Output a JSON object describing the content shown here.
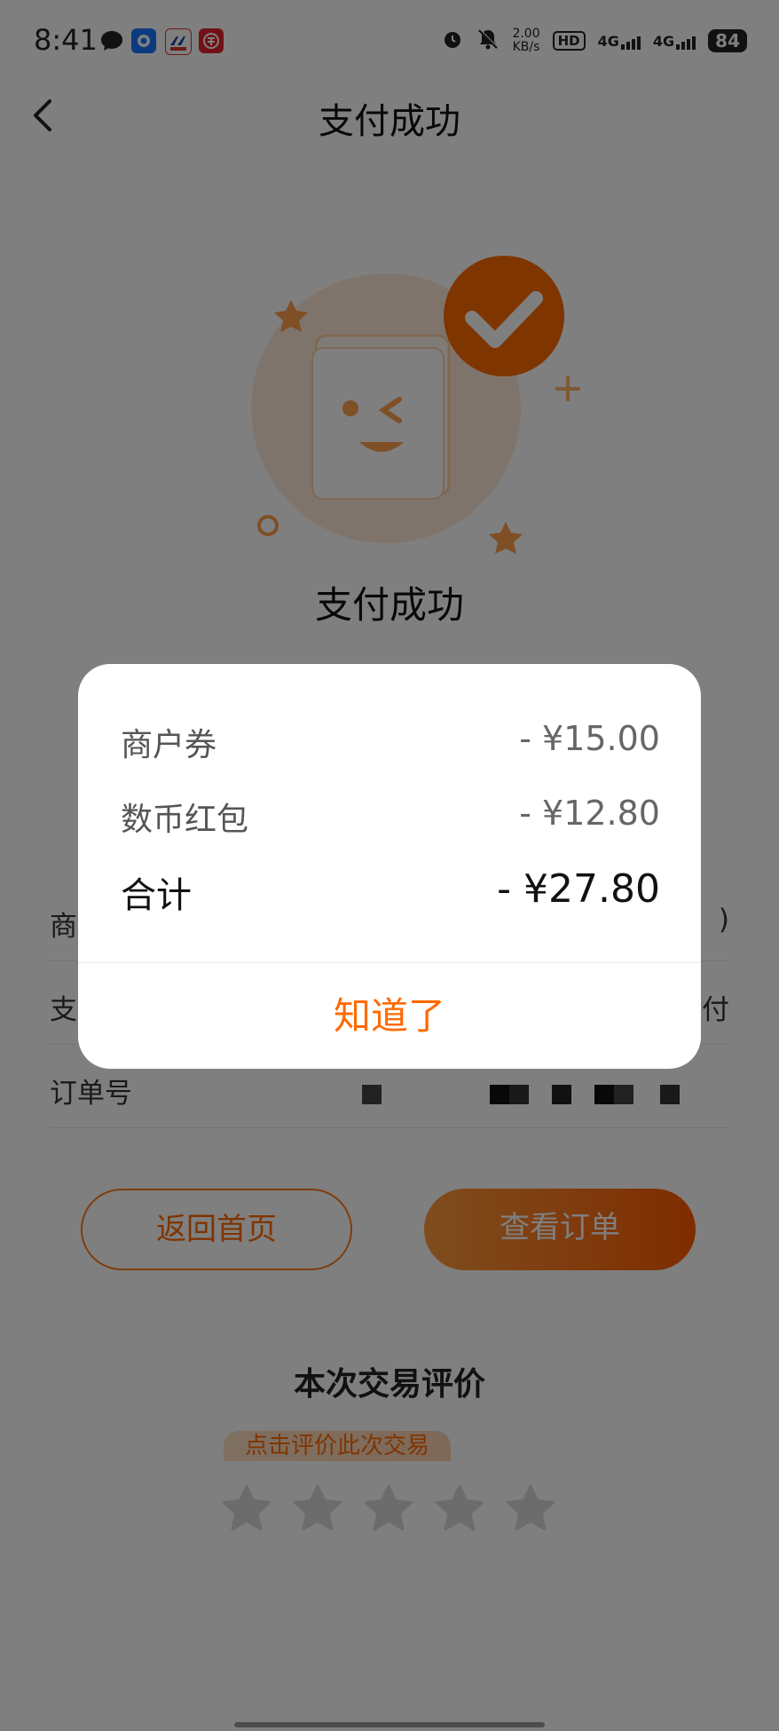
{
  "status_bar": {
    "time": "8:41",
    "net_speed_value": "2.00",
    "net_speed_unit": "KB/s",
    "hd_label": "HD",
    "sim1_label": "4G",
    "sim2_label": "4G",
    "battery": "84"
  },
  "header": {
    "title": "支付成功",
    "back_icon": "chevron-left-icon"
  },
  "hero": {
    "icon": "payment-success-illustration",
    "title": "支付成功"
  },
  "info_rows": [
    {
      "label": "商",
      "value": ")"
    },
    {
      "label": "支",
      "value": "付"
    },
    {
      "label": "订单号",
      "value": ""
    }
  ],
  "buttons": {
    "home": "返回首页",
    "view_order": "查看订单"
  },
  "rating": {
    "title": "本次交易评价",
    "hint": "点击评价此次交易",
    "stars": 5
  },
  "dialog": {
    "rows": [
      {
        "label": "商户券",
        "amount": "- ¥15.00"
      },
      {
        "label": "数币红包",
        "amount": "- ¥12.80"
      }
    ],
    "total": {
      "label": "合计",
      "amount": "- ¥27.80"
    },
    "confirm_label": "知道了"
  },
  "colors": {
    "accent": "#ff6a00",
    "overlay": "rgba(0,0,0,0.5)"
  }
}
